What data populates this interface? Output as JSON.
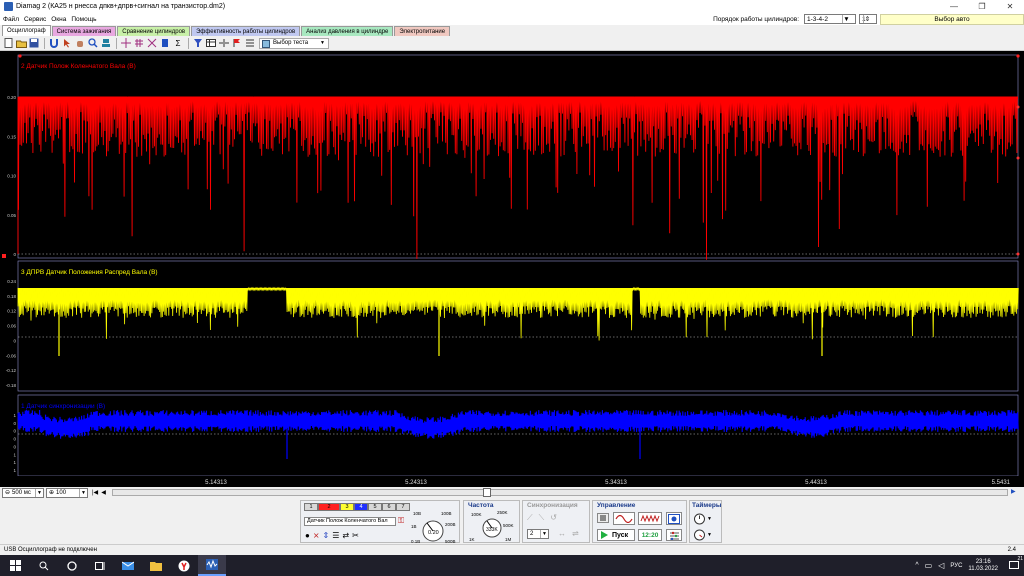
{
  "window": {
    "title": "Diamag 2 (КА25 н рнесса дпкв+дпрв+сигнал на транзистор.dm2)",
    "controls": [
      "—",
      "❐",
      "✕"
    ]
  },
  "menu": {
    "items": [
      "Файл",
      "Сервис",
      "Окна",
      "Помощь"
    ],
    "cyl_order_label": "Порядок работы цилиндров:",
    "cyl_order_value": "1-3-4-2",
    "cyl_num_value": "1",
    "auto_select_label": "Выбор авто"
  },
  "tabs": [
    {
      "label": "Осциллограф",
      "color": "#ffffff"
    },
    {
      "label": "Система зажигания",
      "color": "#e8a8e0"
    },
    {
      "label": "Сравнение цилиндров",
      "color": "#c8f0a8"
    },
    {
      "label": "Эффективность работы цилиндров",
      "color": "#c0c8f0"
    },
    {
      "label": "Анализ давления в цилиндре",
      "color": "#a8e8c0"
    },
    {
      "label": "Электропитание",
      "color": "#f0c8c0"
    }
  ],
  "toolbar": {
    "test_select_label": "Выбор теста"
  },
  "scope": {
    "channels": [
      {
        "title": "2 Датчик Полож Коленчатого Вала (В)",
        "color": "#ff0000",
        "yticks": [
          "0.20",
          "0.15",
          "0.10",
          "0.05",
          "0"
        ]
      },
      {
        "title": "3 ДПРВ Датчик Положения Распред Вала (В)",
        "color": "#ffff00",
        "yticks": [
          "0.24",
          "0.18",
          "0.12",
          "0.06",
          "0",
          "-0.06",
          "-0.12",
          "-0.18"
        ]
      },
      {
        "title": "1 Датчик синхронизации (В)",
        "color": "#0000ff",
        "yticks": [
          "1",
          "0",
          "0",
          "0",
          "0",
          "1",
          "1",
          "1"
        ]
      }
    ],
    "time_labels": [
      "5.14313",
      "5.24313",
      "5.34313",
      "5.44313",
      "5.5431"
    ]
  },
  "timebar": {
    "timebase": "500 мс",
    "zoom": "100"
  },
  "controls": {
    "channel_tabs": [
      "1",
      "2",
      "3",
      "4",
      "5",
      "6",
      "7"
    ],
    "channel_select": "Датчик Полож Коленчатого Вал",
    "voltage_knob": {
      "value": "0.20",
      "labels": [
        "10B",
        "100B",
        "1B",
        "200B",
        "0.1B",
        "500B"
      ]
    },
    "frequency_title": "Частота",
    "frequency_knob": {
      "value": "333K",
      "labels": [
        "100K",
        "250K",
        "500K",
        "1M",
        "1K",
        "333K"
      ]
    },
    "sync_title": "Синхронизация",
    "sync_value": "2",
    "control_title": "Управление",
    "start_label": "Пуск",
    "time_display": "12:20",
    "timers_title": "Таймеры"
  },
  "status": {
    "text": "USB Осциллограф не подключен",
    "right": "2.4"
  },
  "taskbar": {
    "lang": "РУС",
    "time": "23:16",
    "date": "11.03.2022",
    "notif_count": "21"
  }
}
